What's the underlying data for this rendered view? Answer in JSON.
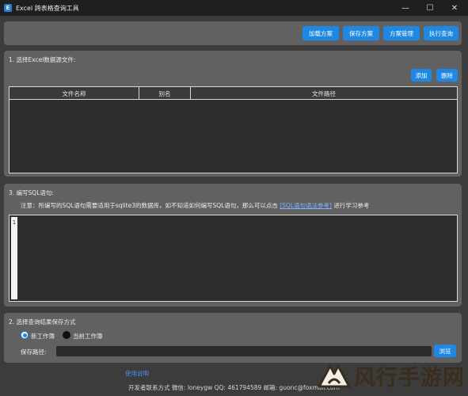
{
  "window": {
    "icon_letter": "E",
    "title": "Excel 跨表格查询工具",
    "minimize_glyph": "—",
    "maximize_glyph": "☐",
    "close_glyph": "✕"
  },
  "toolbar": {
    "load_scheme": "加载方案",
    "save_scheme": "保存方案",
    "manage_scheme": "方案管理",
    "run_query": "执行查询"
  },
  "sources": {
    "heading": "1. 选择Excel数据源文件:",
    "add_label": "添加",
    "delete_label": "删除",
    "columns": [
      "文件名称",
      "别名",
      "文件路径"
    ],
    "rows": []
  },
  "sql": {
    "heading": "3. 编写SQL语句:",
    "note_before": "注意：所编写的SQL语句需要适用于sqlite3的数据库，如不知道如何编写SQL语句，那么可以点击 ",
    "note_link": "[SQL语句语法参考]",
    "note_after": " 进行学习参考",
    "line_number": "1",
    "content": ""
  },
  "output": {
    "heading": "2. 选择查询结果保存方式",
    "option_new": "新工作簿",
    "option_current": "当前工作簿",
    "selected": "新工作簿",
    "path_label": "保存路径:",
    "path_value": "",
    "browse_label": "浏览"
  },
  "footer": {
    "link_text": "使用说明",
    "contact": "开发者联系方式   微信: loneygw    QQ: 461794589    邮箱: guonc@foxmail.com"
  },
  "watermark": {
    "text": "风行手游网"
  },
  "colors": {
    "accent": "#1e88e5",
    "panel": "#616161",
    "background": "#3c3c3c",
    "titlebar": "#1f1f1f"
  }
}
